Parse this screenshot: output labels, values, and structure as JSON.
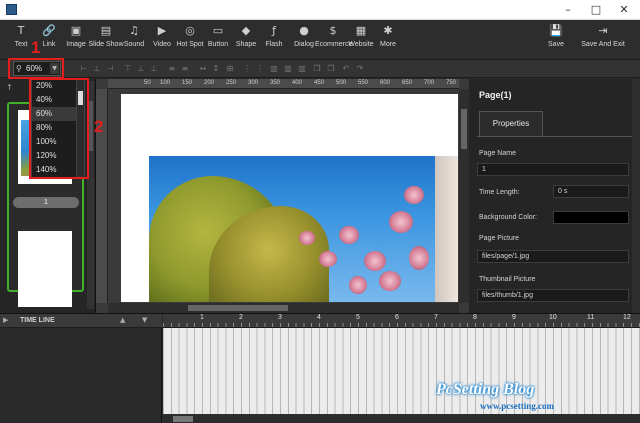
{
  "window": {
    "minimize": "–",
    "maximize": "□",
    "close": "✕"
  },
  "toolbar": {
    "items": [
      {
        "label": "Text",
        "icon": "T"
      },
      {
        "label": "Link",
        "icon": "🔗"
      },
      {
        "label": "Image",
        "icon": "▣"
      },
      {
        "label": "Slide Show",
        "icon": "▤"
      },
      {
        "label": "Sound",
        "icon": "♫"
      },
      {
        "label": "Video",
        "icon": "▶"
      },
      {
        "label": "Hot Spot",
        "icon": "◎"
      },
      {
        "label": "Button",
        "icon": "▭"
      },
      {
        "label": "Shape",
        "icon": "◆"
      },
      {
        "label": "Flash",
        "icon": "ƒ"
      },
      {
        "label": "Dialog",
        "icon": "●"
      },
      {
        "label": "Ecommerce",
        "icon": "$"
      },
      {
        "label": "Website",
        "icon": "▦"
      },
      {
        "label": "More",
        "icon": "✱"
      }
    ],
    "save": {
      "label": "Save",
      "icon": "💾"
    },
    "save_exit": {
      "label": "Save And Exit",
      "icon": "⇥"
    }
  },
  "zoom": {
    "value": "60%",
    "options": [
      "20%",
      "40%",
      "60%",
      "80%",
      "100%",
      "120%",
      "140%"
    ],
    "selected_index": 2
  },
  "annotations": {
    "one": "1",
    "two": "2"
  },
  "ruler": {
    "ticks": [
      "50",
      "100",
      "150",
      "200",
      "250",
      "300",
      "350",
      "400",
      "450",
      "500",
      "550",
      "600",
      "650",
      "700",
      "750"
    ]
  },
  "thumbnails": {
    "page1_number": "1"
  },
  "properties": {
    "title": "Page(1)",
    "tab": "Properties",
    "page_name_label": "Page Name",
    "page_name_value": "1",
    "time_length_label": "Time Length:",
    "time_length_value": "0 s",
    "background_color_label": "Background Color:",
    "background_color": "#000000",
    "page_picture_label": "Page Picture",
    "page_picture_value": "files/page/1.jpg",
    "thumbnail_picture_label": "Thumbnail Picture",
    "thumbnail_picture_value": "files/thumb/1.jpg"
  },
  "timeline": {
    "label": "TIME LINE",
    "ruler_numbers": [
      "1",
      "2",
      "3",
      "4",
      "5",
      "6",
      "7",
      "8",
      "9",
      "10",
      "11",
      "12"
    ]
  },
  "watermark": {
    "line1": "PcSetting Blog",
    "line2": "www.pcsetting.com"
  },
  "colors": {
    "accent_red": "#e51d1d",
    "thumb_border_green": "#43b02a"
  }
}
